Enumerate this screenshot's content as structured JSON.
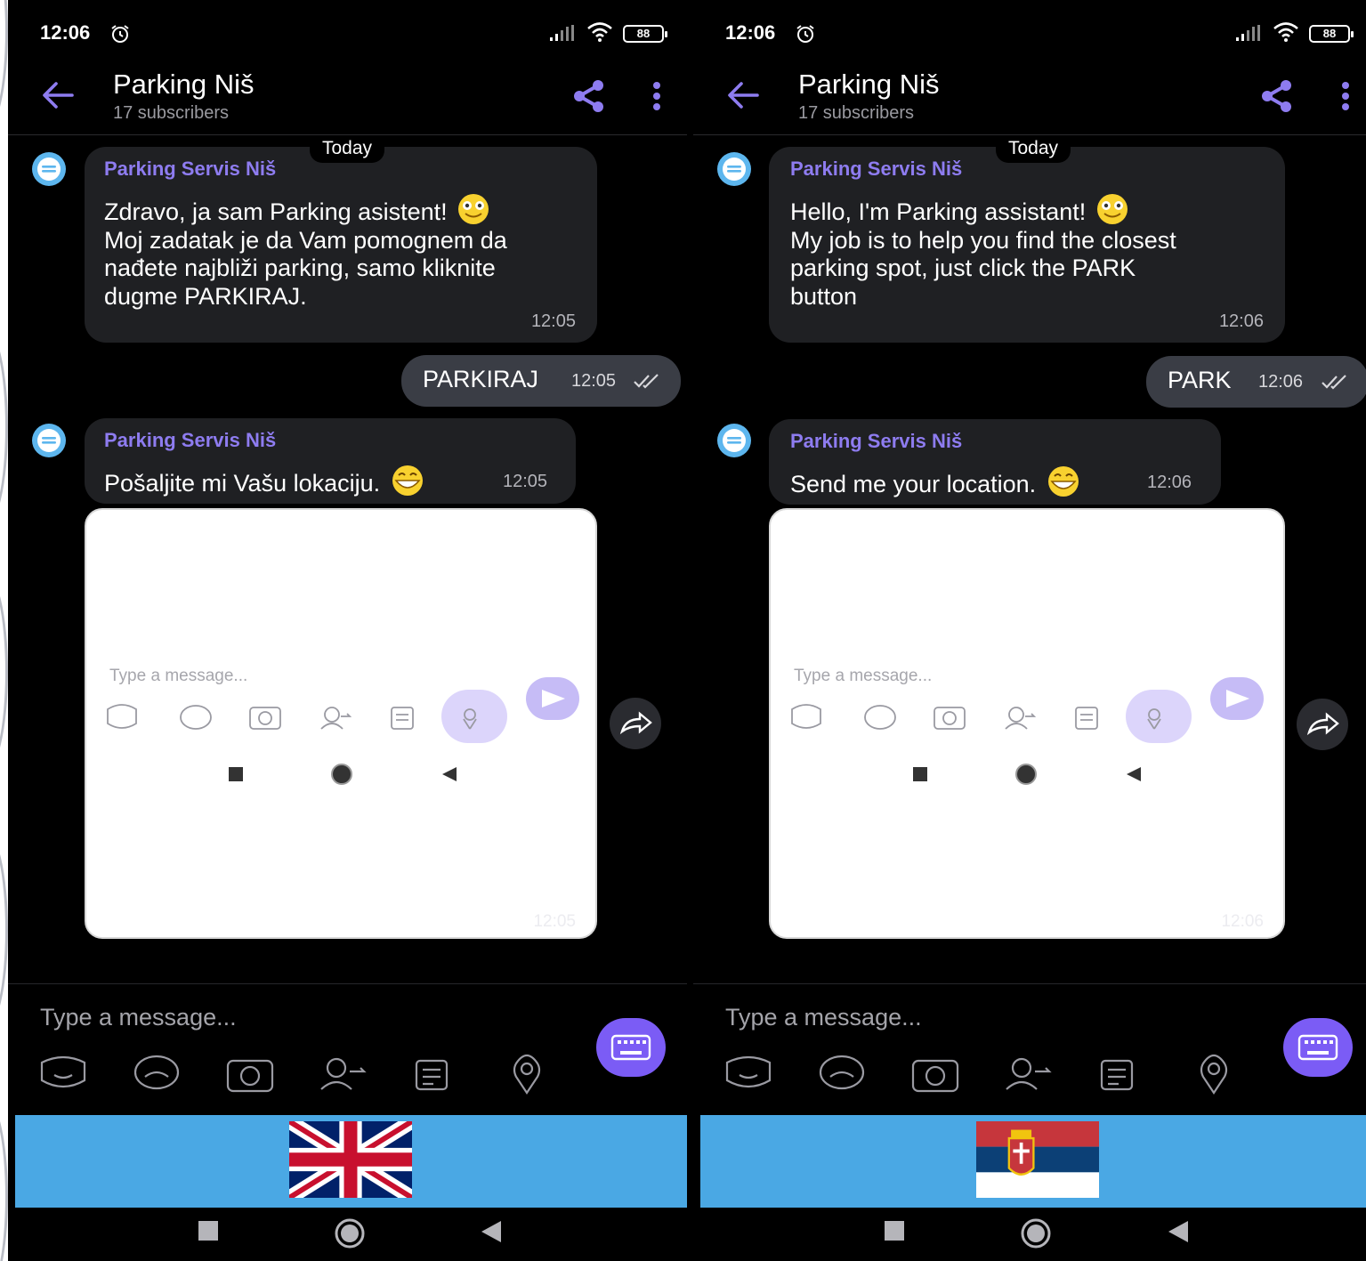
{
  "phones": [
    {
      "status": {
        "time": "12:06",
        "battery": "88"
      },
      "header": {
        "title": "Parking Niš",
        "subtitle": "17 subscribers"
      },
      "date_chip": "Today",
      "messages": [
        {
          "sender": "Parking Servis Niš",
          "lines": [
            "Zdravo, ja sam Parking asistent!",
            "Moj zadatak je da Vam pomognem da",
            "nađete najbliži parking, samo kliknite",
            "dugme PARKIRAJ."
          ],
          "time": "12:05"
        },
        {
          "outgoing": "PARKIRAJ",
          "time": "12:05"
        },
        {
          "sender": "Parking Servis Niš",
          "text": "Pošaljite mi Vašu lokaciju.",
          "time": "12:05"
        }
      ],
      "screenshot": {
        "placeholder": "Type a message...",
        "time": "12:05"
      },
      "composer": {
        "placeholder": "Type a message..."
      },
      "flag": "united-kingdom-flag"
    },
    {
      "status": {
        "time": "12:06",
        "battery": "88"
      },
      "header": {
        "title": "Parking Niš",
        "subtitle": "17 subscribers"
      },
      "date_chip": "Today",
      "messages": [
        {
          "sender": "Parking Servis Niš",
          "lines": [
            "Hello, I'm Parking assistant!",
            "My job is to help you find the closest",
            "parking spot, just click the PARK",
            "button"
          ],
          "time": "12:06"
        },
        {
          "outgoing": "PARK",
          "time": "12:06"
        },
        {
          "sender": "Parking Servis Niš",
          "text": "Send me your location.",
          "time": "12:06"
        }
      ],
      "screenshot": {
        "placeholder": "Type a message...",
        "time": "12:06"
      },
      "composer": {
        "placeholder": "Type a message..."
      },
      "flag": "serbia-flag"
    }
  ],
  "colors": {
    "accent": "#7b5cf5",
    "sender": "#8e7cf0",
    "bubble": "#1f2023",
    "outgoing_bubble": "#3a3d45",
    "flag_bar": "#4aa8e4"
  }
}
